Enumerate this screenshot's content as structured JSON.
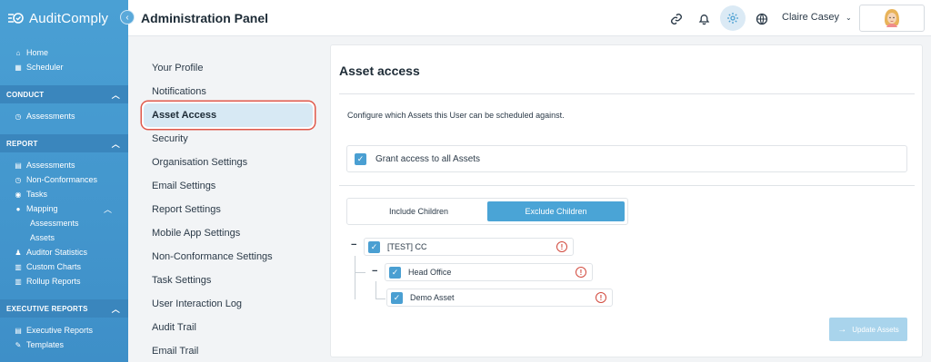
{
  "app": {
    "brand": "AuditComply"
  },
  "sidebar": {
    "top_items": [
      {
        "label": "Home",
        "icon": "home-icon"
      },
      {
        "label": "Scheduler",
        "icon": "calendar-icon"
      }
    ],
    "sections": {
      "conduct": {
        "title": "CONDUCT",
        "items": [
          "Assessments"
        ]
      },
      "report": {
        "title": "REPORT",
        "items": [
          "Assessments",
          "Non-Conformances",
          "Tasks",
          "Mapping"
        ],
        "mapping_sub": [
          "Assessments",
          "Assets"
        ],
        "items_after": [
          "Auditor Statistics",
          "Custom Charts",
          "Rollup Reports"
        ]
      },
      "executive": {
        "title": "EXECUTIVE REPORTS",
        "items": [
          "Executive Reports",
          "Templates"
        ]
      }
    }
  },
  "header": {
    "title": "Administration Panel",
    "user_name": "Claire Casey"
  },
  "settings_menu": {
    "items": [
      "Your Profile",
      "Notifications",
      "Asset Access",
      "Security",
      "Organisation Settings",
      "Email Settings",
      "Report Settings",
      "Mobile App Settings",
      "Non-Conformance Settings",
      "Task Settings",
      "User Interaction Log",
      "Audit Trail",
      "Email Trail"
    ],
    "active": "Asset Access"
  },
  "asset_access": {
    "title": "Asset access",
    "description": "Configure which Assets this User can be scheduled against.",
    "grant_all_label": "Grant access to all Assets",
    "grant_all_checked": true,
    "segment": {
      "include": "Include Children",
      "exclude": "Exclude Children",
      "selected": "Exclude Children"
    },
    "tree": {
      "root": {
        "label": "[TEST] CC",
        "checked": true
      },
      "child": {
        "label": "Head Office",
        "checked": true
      },
      "leaf": {
        "label": "Demo Asset",
        "checked": true
      }
    },
    "update_button": "Update Assets"
  },
  "colors": {
    "sidebar": "#4aa0d4",
    "accent": "#4aa4d6",
    "highlight_outline": "#e0584a",
    "warning": "#d24a3e"
  }
}
